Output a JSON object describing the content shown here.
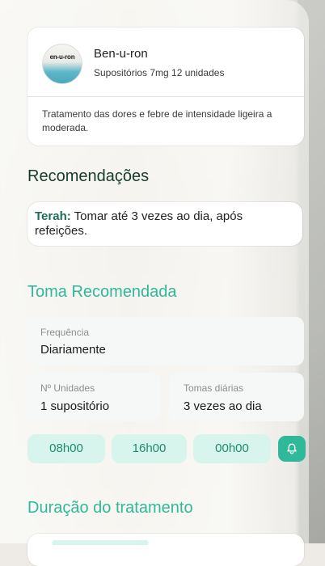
{
  "product": {
    "thumb_text": "en-u-ron",
    "name": "Ben-u-ron",
    "subtitle": "Supositórios 7mg 12 unidades",
    "description": "Tratamento das dores e febre de intensidade ligeira a moderada."
  },
  "recommendations": {
    "title": "Recomendações",
    "source": "Terah:",
    "text": " Tomar até 3 vezes ao dia, após refeições."
  },
  "dose": {
    "title": "Toma Recomendada",
    "frequency_label": "Frequência",
    "frequency_value": "Diariamente",
    "units_label": "Nº Unidades",
    "units_value": "1 supositório",
    "daily_label": "Tomas diárias",
    "daily_value": "3 vezes ao dia",
    "times": [
      "08h00",
      "16h00",
      "00h00"
    ],
    "bell_icon": "bell-icon"
  },
  "duration": {
    "title": "Duração do tratamento"
  },
  "colors": {
    "accent": "#2fb99a",
    "accent_light": "#d7f5ec",
    "heading_dark": "#163a2e"
  }
}
